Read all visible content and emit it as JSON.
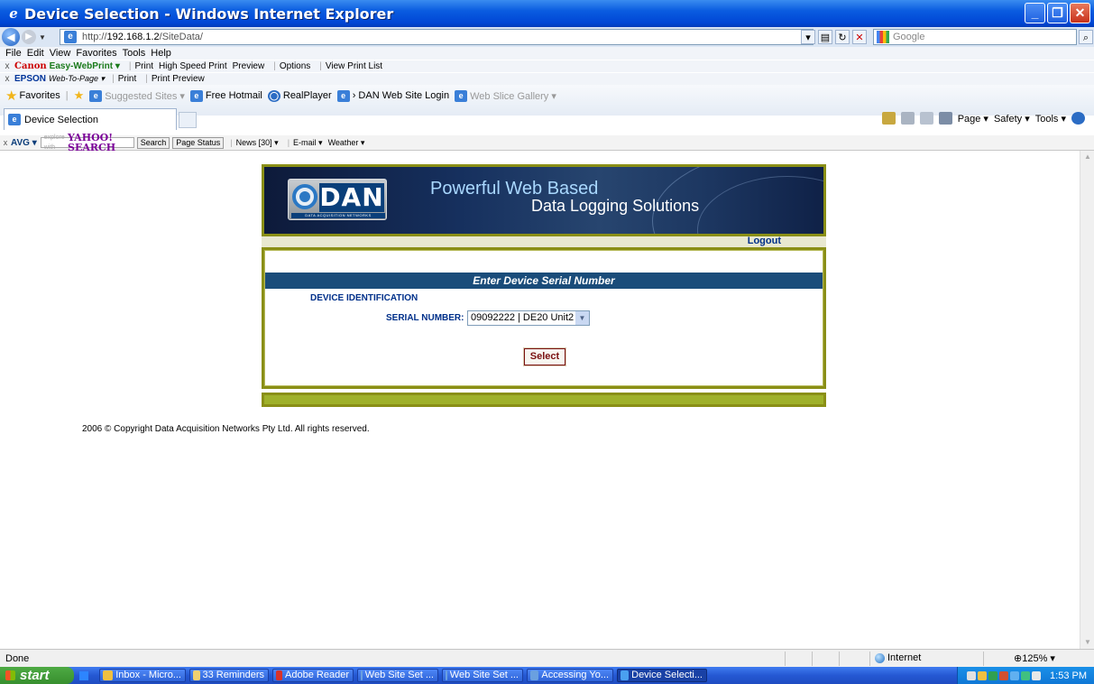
{
  "window": {
    "title": "Device Selection - Windows Internet Explorer",
    "min": "_",
    "max": "❐",
    "close": "✕"
  },
  "address": {
    "url_prefix": "http://",
    "url_host": "192.168.1.2",
    "url_path": "/SiteData/",
    "search_placeholder": "Google"
  },
  "menu": [
    "File",
    "Edit",
    "View",
    "Favorites",
    "Tools",
    "Help"
  ],
  "canon_toolbar": {
    "brand": "Canon",
    "product": "Easy-WebPrint ▾",
    "items": [
      "Print",
      "High Speed Print",
      "Preview",
      "Options",
      "View Print List"
    ]
  },
  "epson_toolbar": {
    "brand": "EPSON",
    "product": "Web-To-Page ▾",
    "items": [
      "Print",
      "Print Preview"
    ]
  },
  "favorites": {
    "label": "Favorites",
    "items": [
      "Suggested Sites ▾",
      "Free Hotmail",
      "RealPlayer",
      "› DAN Web Site Login",
      "Web Slice Gallery ▾"
    ]
  },
  "tab": {
    "label": "Device Selection"
  },
  "command_bar": [
    "Page ▾",
    "Safety ▾",
    "Tools ▾"
  ],
  "avg_bar": {
    "brand": "AVG ▾",
    "yahoo": "YAHOO! SEARCH",
    "yahoo_prefix": "explore with",
    "search": "Search",
    "page_status": "Page Status",
    "news": "News [30] ▾",
    "email": "E-mail ▾",
    "weather": "Weather ▾"
  },
  "banner": {
    "logo": "DAN",
    "logo_sub": "DATA ACQUISITION NETWORKS",
    "tagline1": "Powerful Web Based",
    "tagline2": "Data Logging Solutions"
  },
  "logout": "Logout",
  "form": {
    "header": "Enter Device Serial Number",
    "section": "DEVICE IDENTIFICATION",
    "serial_label": "SERIAL NUMBER:",
    "serial_value": "09092222 | DE20 Unit2",
    "select_button": "Select"
  },
  "copyright": "2006 © Copyright Data Acquisition Networks Pty Ltd. All rights reserved.",
  "status": {
    "text": "Done",
    "zone": "Internet",
    "zoom": "125%"
  },
  "taskbar": {
    "start": "start",
    "tasks": [
      "Inbox - Micro...",
      "33 Reminders",
      "Adobe Reader",
      "Web Site Set ...",
      "Web Site Set ...",
      "Accessing Yo...",
      "Device Selecti..."
    ],
    "clock": "1:53 PM"
  },
  "colors": {
    "brand_olive": "#8a8f16",
    "header_blue": "#1a4c7a",
    "label_blue": "#00308a",
    "button_red": "#7a1010"
  }
}
